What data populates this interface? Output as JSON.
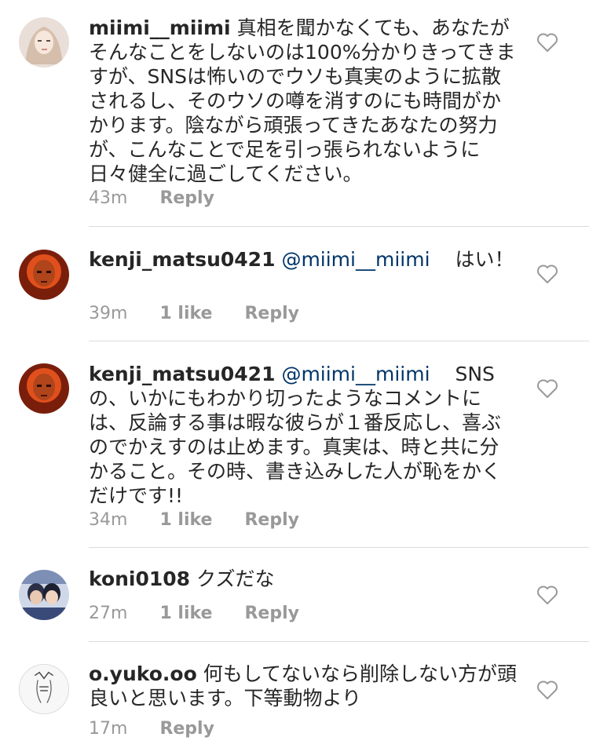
{
  "comments": [
    {
      "username": "miimi__miimi",
      "mention": "",
      "text": "真相を聞かなくても、あなたがそんなことをしないのは100%分かりきってきますが、SNSは怖いのでウソも真実のように拡散されるし、そのウソの噂を消すのにも時間がかかります。陰ながら頑張ってきたあなたの努力が、こんなことで足を引っ張られないように日々健全に過ごしてください。",
      "time": "43m",
      "likes": "",
      "reply": "Reply"
    },
    {
      "username": "kenji_matsu0421",
      "mention": "@miimi__miimi",
      "text": "はい！",
      "time": "39m",
      "likes": "1 like",
      "reply": "Reply"
    },
    {
      "username": "kenji_matsu0421",
      "mention": "@miimi__miimi",
      "text": "SNSの、いかにもわかり切ったようなコメントには、反論する事は暇な彼らが１番反応し、喜ぶのでかえすのは止めます。真実は、時と共に分かること。その時、書き込みした人が恥をかくだけです!!",
      "time": "34m",
      "likes": "1 like",
      "reply": "Reply"
    },
    {
      "username": "koni0108",
      "mention": "",
      "text": "クズだな",
      "time": "27m",
      "likes": "1 like",
      "reply": "Reply"
    },
    {
      "username": "o.yuko.oo",
      "mention": "",
      "text": "何もしてないなら削除しない方が頭良いと思います。下等動物より",
      "time": "17m",
      "likes": "",
      "reply": "Reply"
    }
  ],
  "icons": {
    "like": "heart-outline-icon",
    "avatar": "user-avatar"
  },
  "colors": {
    "text": "#262626",
    "mention": "#003569",
    "meta": "#999999",
    "divider": "#dbdbdb"
  }
}
